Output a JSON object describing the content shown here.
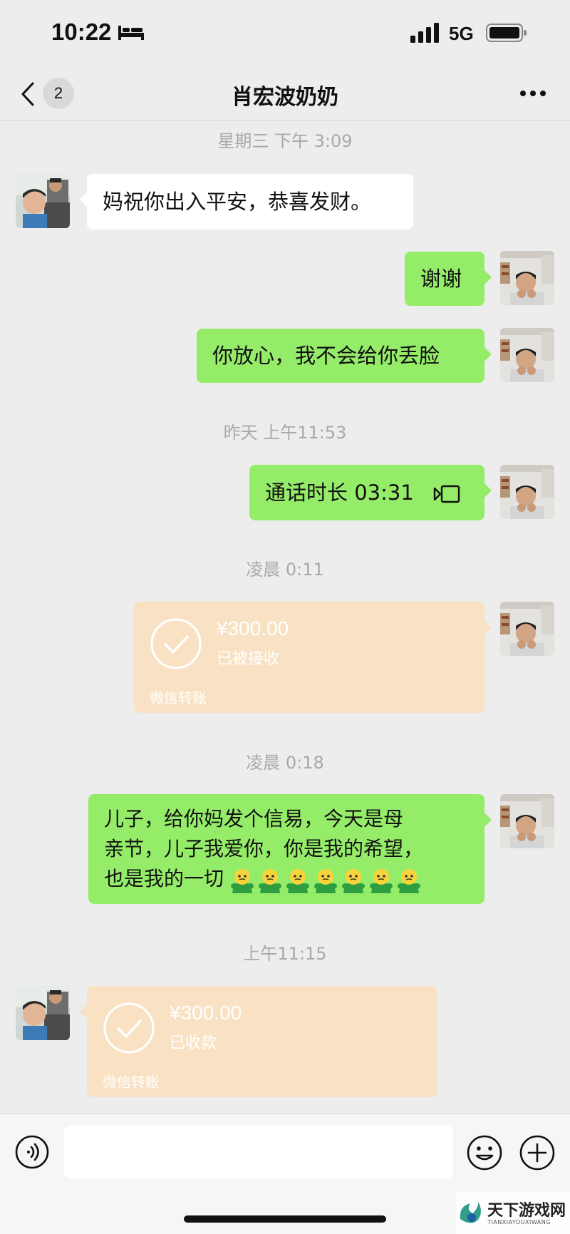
{
  "status_bar": {
    "time": "10:22",
    "network": "5G"
  },
  "nav": {
    "unread_count": "2",
    "title": "肖宏波奶奶"
  },
  "timestamps": [
    "星期三 下午 3:09",
    "昨天 上午11:53",
    "凌晨 0:11",
    "凌晨 0:18",
    "上午11:15"
  ],
  "messages": [
    {
      "text": "妈祝你出入平安，恭喜发财。"
    },
    {
      "text": "谢谢"
    },
    {
      "text": "你放心，我不会给你丢脸"
    },
    {
      "text": "通话时长 03:31"
    },
    {
      "amount": "¥300.00",
      "status": "已被接收",
      "footer": "微信转账"
    },
    {
      "line1": "儿子，给你妈发个信易，今天是母",
      "line2": "亲节，儿子我爱你，你是我的希望，",
      "line3": "也是我的一切"
    },
    {
      "amount": "¥300.00",
      "status": "已收款",
      "footer": "微信转账"
    }
  ],
  "watermark": {
    "cn": "天下游戏网",
    "en": "TIANXIAYOUXIWANG"
  },
  "colors": {
    "outgoing_bubble": "#95ec69",
    "incoming_bubble": "#ffffff",
    "transfer_card": "#f9e2c4",
    "background": "#ededed"
  }
}
